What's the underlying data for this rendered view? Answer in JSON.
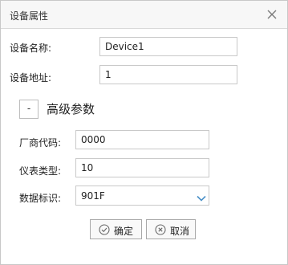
{
  "dialog": {
    "title": "设备属性",
    "close_icon": "close-icon"
  },
  "fields": {
    "device_name": {
      "label": "设备名称:",
      "value": "Device1"
    },
    "device_address": {
      "label": "设备地址:",
      "value": "1"
    }
  },
  "advanced": {
    "toggle_symbol": "-",
    "title": "高级参数",
    "vendor_code": {
      "label": "厂商代码:",
      "value": "0000"
    },
    "meter_type": {
      "label": "仪表类型:",
      "value": "10"
    },
    "data_id": {
      "label": "数据标识:",
      "selected": "901F",
      "arrow_icon": "chevron-down-icon"
    }
  },
  "buttons": {
    "ok": {
      "label": "确定",
      "icon": "check-circle-icon"
    },
    "cancel": {
      "label": "取消",
      "icon": "x-circle-icon"
    }
  },
  "colors": {
    "accent": "#4a90c8",
    "border": "#c9c9c9",
    "titlebar": "#f7f7f7"
  }
}
